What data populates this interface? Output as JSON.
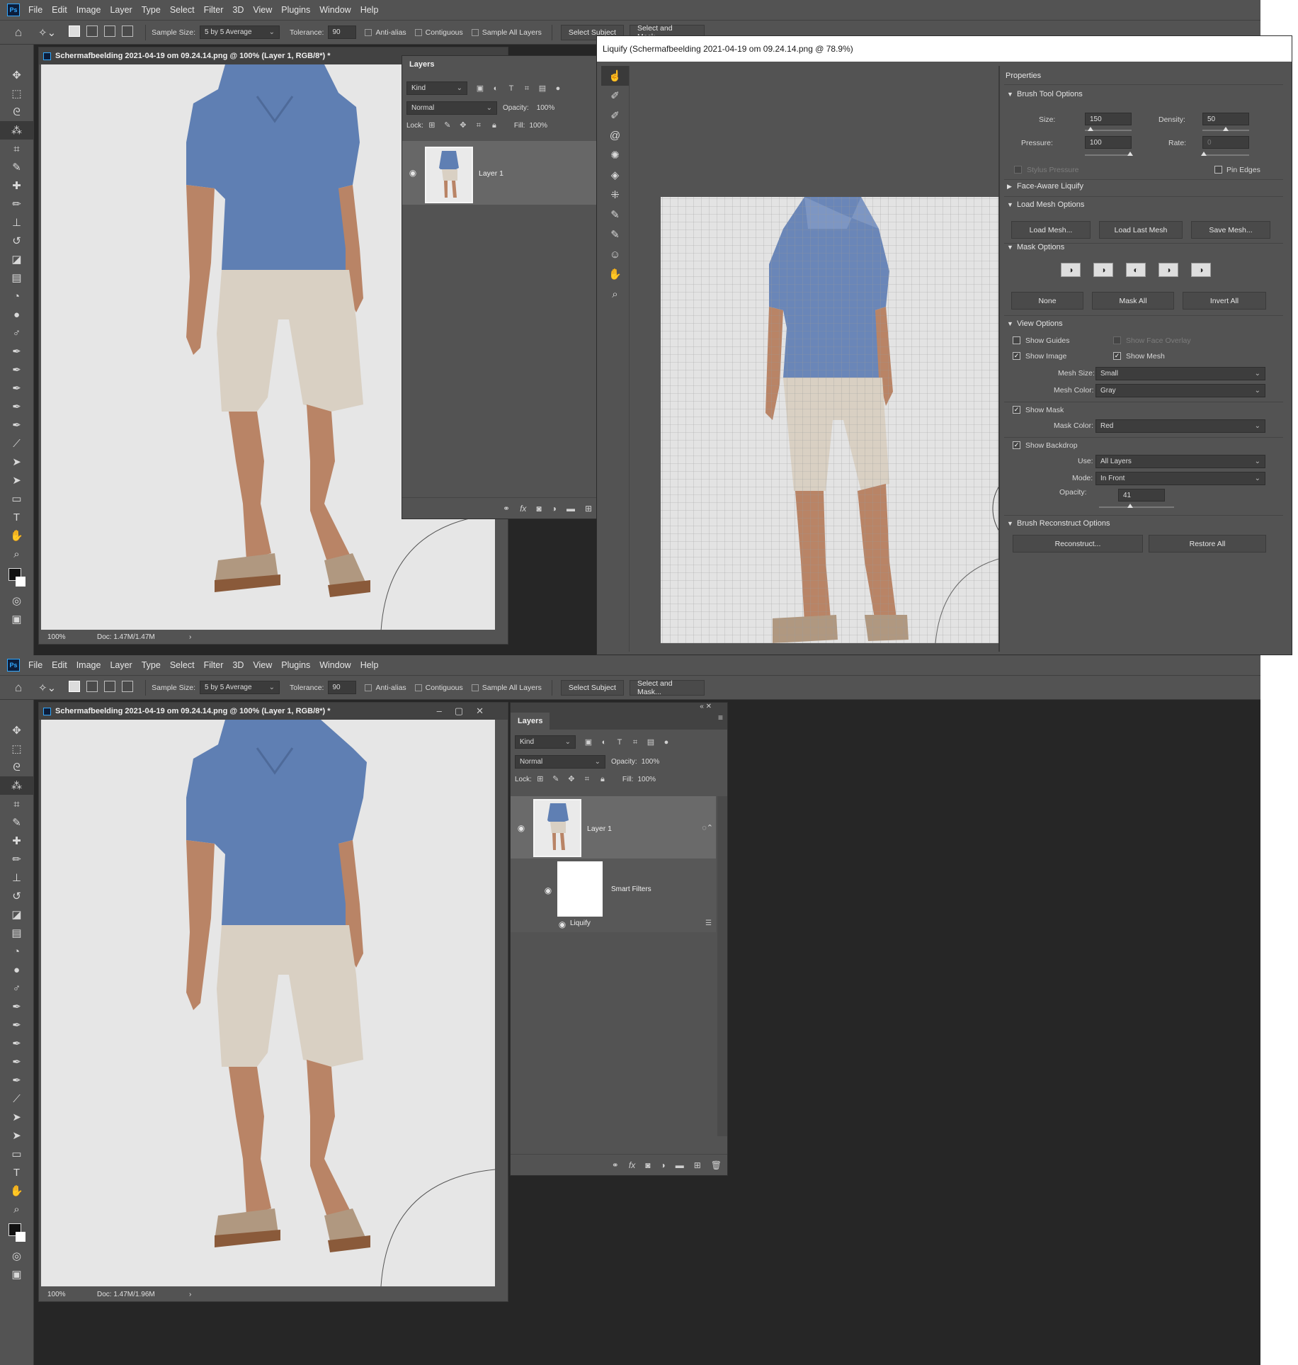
{
  "menu": [
    "File",
    "Edit",
    "Image",
    "Layer",
    "Type",
    "Select",
    "Filter",
    "3D",
    "View",
    "Plugins",
    "Window",
    "Help"
  ],
  "options_bar": {
    "sample_size_label": "Sample Size:",
    "sample_size_value": "5 by 5 Average",
    "tolerance_label": "Tolerance:",
    "tolerance_value": "90",
    "anti_alias": "Anti-alias",
    "contiguous": "Contiguous",
    "sample_all_layers": "Sample All Layers",
    "select_subject": "Select Subject",
    "select_and_mask": "Select and Mask..."
  },
  "document": {
    "title": "Schermafbeelding 2021-04-19 om 09.24.14.png @ 100% (Layer 1, RGB/8*) *",
    "zoom": "100%",
    "doc_size_top": "Doc: 1.47M/1.47M",
    "doc_size_bottom": "Doc: 1.47M/1.96M"
  },
  "layers_panel": {
    "tab": "Layers",
    "kind": "Kind",
    "blend_mode": "Normal",
    "opacity_label": "Opacity:",
    "opacity_value": "100%",
    "lock_label": "Lock:",
    "fill_label": "Fill:",
    "fill_value": "100%",
    "layer_name": "Layer 1",
    "smart_filters": "Smart Filters",
    "filter_name": "Liquify"
  },
  "liquify": {
    "title": "Liquify (Schermafbeelding 2021-04-19 om 09.24.14.png @ 78.9%)",
    "properties": "Properties",
    "brush_tool_options": "Brush Tool Options",
    "size_label": "Size:",
    "size_value": "150",
    "density_label": "Density:",
    "density_value": "50",
    "pressure_label": "Pressure:",
    "pressure_value": "100",
    "rate_label": "Rate:",
    "rate_value": "0",
    "stylus_pressure": "Stylus Pressure",
    "pin_edges": "Pin Edges",
    "face_aware": "Face-Aware Liquify",
    "load_mesh_options": "Load Mesh Options",
    "load_mesh": "Load Mesh...",
    "load_last_mesh": "Load Last Mesh",
    "save_mesh": "Save Mesh...",
    "mask_options": "Mask Options",
    "none": "None",
    "mask_all": "Mask All",
    "invert_all": "Invert All",
    "view_options": "View Options",
    "show_guides": "Show Guides",
    "show_face_overlay": "Show Face Overlay",
    "show_image": "Show Image",
    "show_mesh": "Show Mesh",
    "mesh_size_label": "Mesh Size:",
    "mesh_size_value": "Small",
    "mesh_color_label": "Mesh Color:",
    "mesh_color_value": "Gray",
    "show_mask": "Show Mask",
    "mask_color_label": "Mask Color:",
    "mask_color_value": "Red",
    "show_backdrop": "Show Backdrop",
    "use_label": "Use:",
    "use_value": "All Layers",
    "mode_label": "Mode:",
    "mode_value": "In Front",
    "opacity_label": "Opacity:",
    "opacity_value": "41",
    "brush_reconstruct_options": "Brush Reconstruct Options",
    "reconstruct": "Reconstruct...",
    "restore_all": "Restore All"
  },
  "colors": {
    "ui_bg": "#535353",
    "dark_bg": "#262626",
    "accent": "#31a8ff",
    "shirt": "#5f7fb3",
    "shorts": "#d9d0c3",
    "skin": "#b98466",
    "shoes": "#b09880"
  }
}
